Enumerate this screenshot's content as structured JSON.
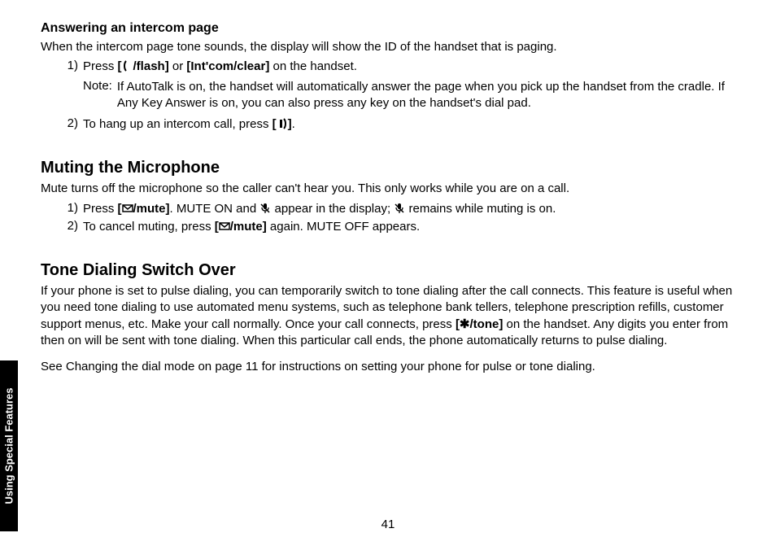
{
  "side_tab": "Using Special Features",
  "page_number": "41",
  "sec1": {
    "title": "Answering an intercom page",
    "intro": "When the intercom page tone sounds, the display will show the ID of the handset that is paging.",
    "step1_num": "1)",
    "step1_a": "Press ",
    "step1_flash": "/flash]",
    "step1_or": " or ",
    "step1_int": "[Int'com/clear]",
    "step1_end": " on the handset.",
    "note_label": "Note:",
    "note_text": "If AutoTalk is on, the handset will automatically answer the page when you pick up the handset from the cradle. If Any Key Answer is on, you can also press any key on the handset's dial pad.",
    "step2_num": "2)",
    "step2_a": "To hang up an intercom call, press ",
    "step2_end": "."
  },
  "sec2": {
    "title": "Muting the Microphone",
    "intro": "Mute turns off the microphone so the caller can't hear you. This only works while you are on a call.",
    "step1_num": "1)",
    "step1_a": "Press ",
    "step1_mute": "/mute]",
    "step1_b": ". MUTE ON and ",
    "step1_c": " appear in the display; ",
    "step1_d": " remains while muting is on.",
    "step2_num": "2)",
    "step2_a": "To cancel muting, press ",
    "step2_mute": "/mute]",
    "step2_b": " again. MUTE OFF appears."
  },
  "sec3": {
    "title": "Tone Dialing Switch Over",
    "p1_a": "If your phone is set to pulse dialing, you can temporarily switch to tone dialing after the call connects. This feature is useful when you need tone dialing to use automated menu systems, such as telephone bank tellers, telephone prescription refills, customer support menus, etc. Make your call normally. Once your call connects, press ",
    "p1_tone": "[✱/tone]",
    "p1_b": " on the handset. Any digits you enter from then on will be sent with tone dialing. When this particular call ends, the phone automatically returns to pulse dialing.",
    "p2": "See Changing the dial mode on page 11 for instructions on setting your phone for pulse or tone dialing."
  }
}
